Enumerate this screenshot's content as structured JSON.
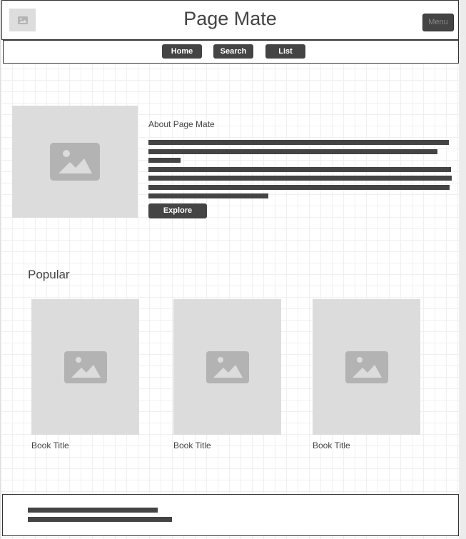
{
  "header": {
    "title": "Page Mate",
    "menu_label": "Menu",
    "logo_icon": "image-icon"
  },
  "nav": {
    "items": [
      {
        "label": "Home"
      },
      {
        "label": "Search"
      },
      {
        "label": "List"
      }
    ]
  },
  "about": {
    "heading": "About Page Mate",
    "image_icon": "image-icon",
    "button_label": "Explore"
  },
  "popular": {
    "heading": "Popular",
    "books": [
      {
        "title": "Book Title",
        "image_icon": "image-icon"
      },
      {
        "title": "Book Title",
        "image_icon": "image-icon"
      },
      {
        "title": "Book Title",
        "image_icon": "image-icon"
      }
    ]
  },
  "colors": {
    "dark": "#444444",
    "placeholder": "#dcdcdc",
    "placeholder_icon": "#b3b3b3"
  }
}
